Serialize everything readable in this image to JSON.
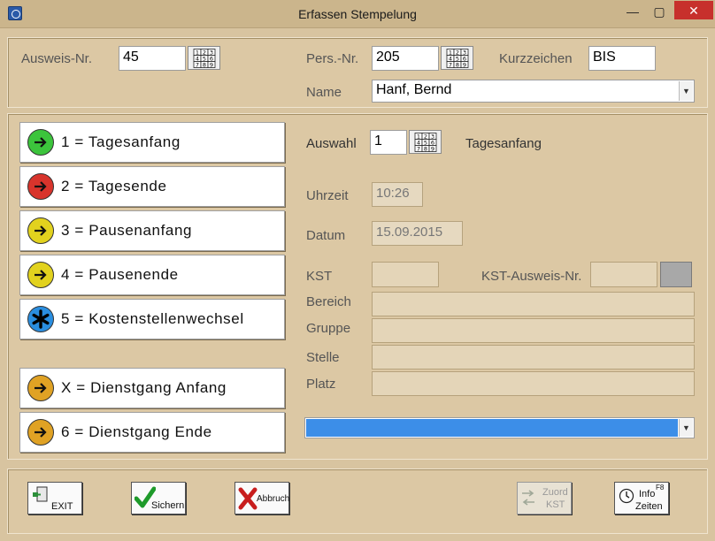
{
  "window": {
    "title": "Erfassen Stempelung",
    "minimize_glyph": "—",
    "maximize_glyph": "▢",
    "close_glyph": "✕",
    "app_icon": "clock-icon"
  },
  "header": {
    "ausweis_label": "Ausweis-Nr.",
    "ausweis_value": "45",
    "pers_label": "Pers.-Nr.",
    "pers_value": "205",
    "kurzzeichen_label": "Kurzzeichen",
    "kurzzeichen_value": "BIS",
    "name_label": "Name",
    "name_value": "Hanf, Bernd"
  },
  "actions": [
    {
      "label": "1 = Tagesanfang",
      "icon": "arrow-right-icon",
      "color": "#3cc43c"
    },
    {
      "label": "2 = Tagesende",
      "icon": "arrow-right-icon",
      "color": "#d8342c"
    },
    {
      "label": "3 = Pausenanfang",
      "icon": "arrow-right-icon",
      "color": "#e2d21e"
    },
    {
      "label": "4 = Pausenende",
      "icon": "arrow-right-icon",
      "color": "#e2d21e"
    },
    {
      "label": "5 = Kostenstellenwechsel",
      "icon": "asterisk-icon",
      "color": "#2a8ee0"
    },
    {
      "label": "X = Dienstgang Anfang",
      "icon": "arrow-right-icon",
      "color": "#e0a224"
    },
    {
      "label": "6 = Dienstgang Ende",
      "icon": "arrow-right-icon",
      "color": "#e0a224"
    }
  ],
  "form": {
    "auswahl_label": "Auswahl",
    "auswahl_value": "1",
    "auswahl_text": "Tagesanfang",
    "uhrzeit_label": "Uhrzeit",
    "uhrzeit_value": "10:26",
    "datum_label": "Datum",
    "datum_value": "15.09.2015",
    "kst_label": "KST",
    "kst_value": "",
    "kst_ausweis_label": "KST-Ausweis-Nr.",
    "kst_ausweis_value": "",
    "bereich_label": "Bereich",
    "gruppe_label": "Gruppe",
    "stelle_label": "Stelle",
    "platz_label": "Platz",
    "selection_color": "#3c8ee8"
  },
  "footer": {
    "exit_label": "EXIT",
    "save_label": "Sichern",
    "cancel_label": "Abbruch",
    "zuord_line1": "Zuord",
    "zuord_line2": "KST",
    "info_line1": "Info",
    "info_line2": "Zeiten",
    "info_badge": "F8"
  },
  "keypad_digits": "123456789"
}
